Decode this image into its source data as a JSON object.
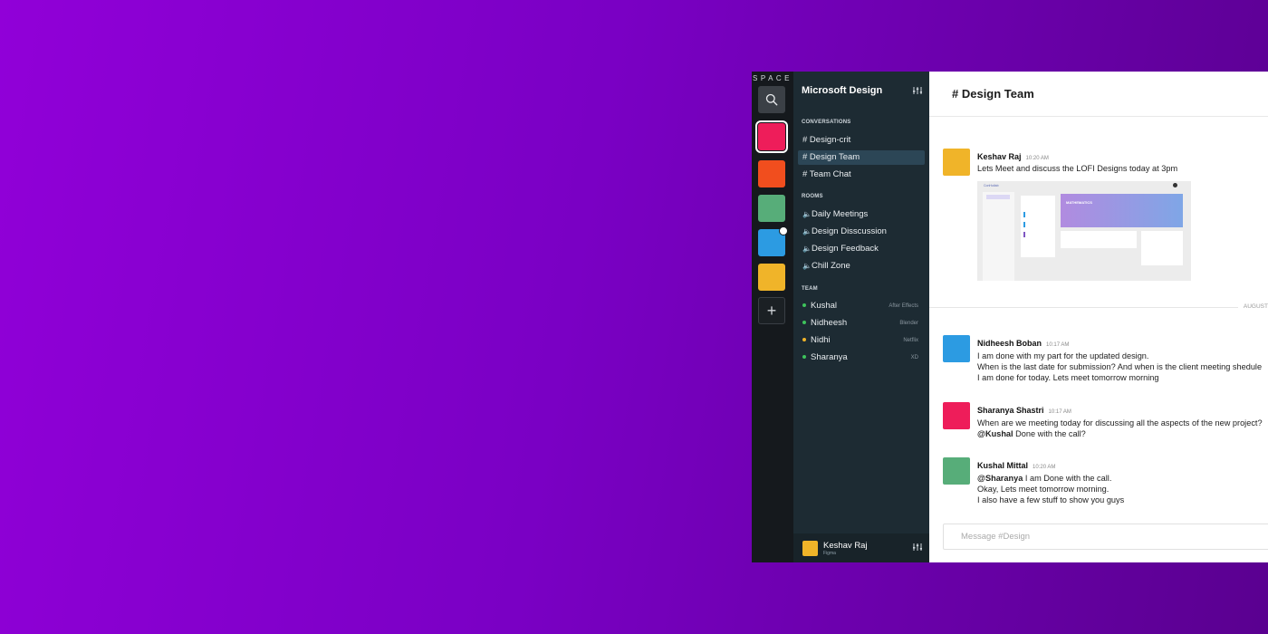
{
  "colors": {
    "rail_bg": "#15191d",
    "sidebar_bg": "#1d2b33",
    "sidebar_active": "#2c4656",
    "online": "#3ec45c",
    "away": "#f0b429"
  },
  "rail": {
    "brand": "SPACE",
    "workspaces": [
      {
        "name": "workspace-1",
        "color": "#ee1d5a",
        "active": true
      },
      {
        "name": "workspace-2",
        "color": "#f14e1e"
      },
      {
        "name": "workspace-3",
        "color": "#57ad79"
      },
      {
        "name": "workspace-4",
        "color": "#2c9be2",
        "notification": true
      },
      {
        "name": "workspace-5",
        "color": "#f0b429"
      }
    ],
    "add_label": "+"
  },
  "sidebar": {
    "org_name": "Microsoft Design",
    "conversations_header": "CONVERSATIONS",
    "conversations": [
      "# Design-crit",
      "# Design Team",
      "# Team Chat"
    ],
    "active_conversation": "# Design Team",
    "rooms_header": "ROOMS",
    "rooms": [
      "Daily Meetings",
      "Design Disscussion",
      "Design Feedback",
      "Chill Zone"
    ],
    "team_header": "TEAM",
    "team": [
      {
        "name": "Kushal",
        "tool": "After Effects",
        "status": "online"
      },
      {
        "name": "Nidheesh",
        "tool": "Blender",
        "status": "online"
      },
      {
        "name": "Nidhi",
        "tool": "Netflix",
        "status": "away"
      },
      {
        "name": "Sharanya",
        "tool": "XD",
        "status": "online"
      }
    ],
    "current_user": {
      "name": "Keshav Raj",
      "subtitle": "Figma"
    }
  },
  "main": {
    "channel_title": "# Design Team",
    "date_divider": "AUGUST",
    "messages": [
      {
        "author": "Keshav Raj",
        "time": "10:20 AM",
        "avatar": "#f0b429",
        "lines": [
          "Lets Meet and discuss the LOFI Designs today at 3pm"
        ]
      },
      {
        "author": "Nidheesh Boban",
        "time": "10:17 AM",
        "avatar": "#2c9be2",
        "lines": [
          "I am done with my part for the updated design.",
          "When is the last date for submission? And when is the client meeting shedule",
          "I am done for today. Lets meet tomorrow morning"
        ]
      },
      {
        "author": "Sharanya Shastri",
        "time": "10:17 AM",
        "avatar": "#ee1d5a",
        "lines": [
          "When are we meeting today for discussing all the aspects of the new project?"
        ],
        "mention": "@Kushal",
        "mention_rest": " Done with the call?"
      },
      {
        "author": "Kushal Mittal",
        "time": "10:20 AM",
        "avatar": "#57ad79",
        "mention": "@Sharanya",
        "mention_rest": " I am Done with the call.",
        "lines": [
          "Okay, Lets meet tomorrow morning.",
          "I also have a few stuff to show you guys"
        ]
      }
    ],
    "attachment": {
      "app_name": "ConHutlab",
      "banner_title": "MATHEMATICS",
      "banner_gradient": [
        "#b18be0",
        "#7fa6e6"
      ]
    },
    "composer_placeholder": "Message #Design"
  }
}
